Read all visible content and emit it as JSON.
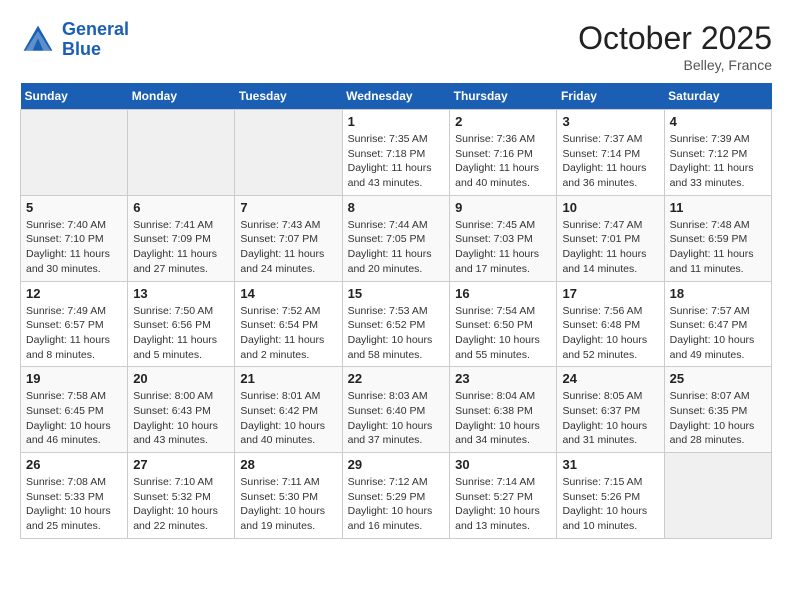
{
  "header": {
    "logo_line1": "General",
    "logo_line2": "Blue",
    "month": "October 2025",
    "location": "Belley, France"
  },
  "weekdays": [
    "Sunday",
    "Monday",
    "Tuesday",
    "Wednesday",
    "Thursday",
    "Friday",
    "Saturday"
  ],
  "weeks": [
    [
      {
        "day": "",
        "empty": true
      },
      {
        "day": "",
        "empty": true
      },
      {
        "day": "",
        "empty": true
      },
      {
        "day": "1",
        "sunrise": "7:35 AM",
        "sunset": "7:18 PM",
        "daylight": "11 hours and 43 minutes."
      },
      {
        "day": "2",
        "sunrise": "7:36 AM",
        "sunset": "7:16 PM",
        "daylight": "11 hours and 40 minutes."
      },
      {
        "day": "3",
        "sunrise": "7:37 AM",
        "sunset": "7:14 PM",
        "daylight": "11 hours and 36 minutes."
      },
      {
        "day": "4",
        "sunrise": "7:39 AM",
        "sunset": "7:12 PM",
        "daylight": "11 hours and 33 minutes."
      }
    ],
    [
      {
        "day": "5",
        "sunrise": "7:40 AM",
        "sunset": "7:10 PM",
        "daylight": "11 hours and 30 minutes."
      },
      {
        "day": "6",
        "sunrise": "7:41 AM",
        "sunset": "7:09 PM",
        "daylight": "11 hours and 27 minutes."
      },
      {
        "day": "7",
        "sunrise": "7:43 AM",
        "sunset": "7:07 PM",
        "daylight": "11 hours and 24 minutes."
      },
      {
        "day": "8",
        "sunrise": "7:44 AM",
        "sunset": "7:05 PM",
        "daylight": "11 hours and 20 minutes."
      },
      {
        "day": "9",
        "sunrise": "7:45 AM",
        "sunset": "7:03 PM",
        "daylight": "11 hours and 17 minutes."
      },
      {
        "day": "10",
        "sunrise": "7:47 AM",
        "sunset": "7:01 PM",
        "daylight": "11 hours and 14 minutes."
      },
      {
        "day": "11",
        "sunrise": "7:48 AM",
        "sunset": "6:59 PM",
        "daylight": "11 hours and 11 minutes."
      }
    ],
    [
      {
        "day": "12",
        "sunrise": "7:49 AM",
        "sunset": "6:57 PM",
        "daylight": "11 hours and 8 minutes."
      },
      {
        "day": "13",
        "sunrise": "7:50 AM",
        "sunset": "6:56 PM",
        "daylight": "11 hours and 5 minutes."
      },
      {
        "day": "14",
        "sunrise": "7:52 AM",
        "sunset": "6:54 PM",
        "daylight": "11 hours and 2 minutes."
      },
      {
        "day": "15",
        "sunrise": "7:53 AM",
        "sunset": "6:52 PM",
        "daylight": "10 hours and 58 minutes."
      },
      {
        "day": "16",
        "sunrise": "7:54 AM",
        "sunset": "6:50 PM",
        "daylight": "10 hours and 55 minutes."
      },
      {
        "day": "17",
        "sunrise": "7:56 AM",
        "sunset": "6:48 PM",
        "daylight": "10 hours and 52 minutes."
      },
      {
        "day": "18",
        "sunrise": "7:57 AM",
        "sunset": "6:47 PM",
        "daylight": "10 hours and 49 minutes."
      }
    ],
    [
      {
        "day": "19",
        "sunrise": "7:58 AM",
        "sunset": "6:45 PM",
        "daylight": "10 hours and 46 minutes."
      },
      {
        "day": "20",
        "sunrise": "8:00 AM",
        "sunset": "6:43 PM",
        "daylight": "10 hours and 43 minutes."
      },
      {
        "day": "21",
        "sunrise": "8:01 AM",
        "sunset": "6:42 PM",
        "daylight": "10 hours and 40 minutes."
      },
      {
        "day": "22",
        "sunrise": "8:03 AM",
        "sunset": "6:40 PM",
        "daylight": "10 hours and 37 minutes."
      },
      {
        "day": "23",
        "sunrise": "8:04 AM",
        "sunset": "6:38 PM",
        "daylight": "10 hours and 34 minutes."
      },
      {
        "day": "24",
        "sunrise": "8:05 AM",
        "sunset": "6:37 PM",
        "daylight": "10 hours and 31 minutes."
      },
      {
        "day": "25",
        "sunrise": "8:07 AM",
        "sunset": "6:35 PM",
        "daylight": "10 hours and 28 minutes."
      }
    ],
    [
      {
        "day": "26",
        "sunrise": "7:08 AM",
        "sunset": "5:33 PM",
        "daylight": "10 hours and 25 minutes."
      },
      {
        "day": "27",
        "sunrise": "7:10 AM",
        "sunset": "5:32 PM",
        "daylight": "10 hours and 22 minutes."
      },
      {
        "day": "28",
        "sunrise": "7:11 AM",
        "sunset": "5:30 PM",
        "daylight": "10 hours and 19 minutes."
      },
      {
        "day": "29",
        "sunrise": "7:12 AM",
        "sunset": "5:29 PM",
        "daylight": "10 hours and 16 minutes."
      },
      {
        "day": "30",
        "sunrise": "7:14 AM",
        "sunset": "5:27 PM",
        "daylight": "10 hours and 13 minutes."
      },
      {
        "day": "31",
        "sunrise": "7:15 AM",
        "sunset": "5:26 PM",
        "daylight": "10 hours and 10 minutes."
      },
      {
        "day": "",
        "empty": true
      }
    ]
  ]
}
